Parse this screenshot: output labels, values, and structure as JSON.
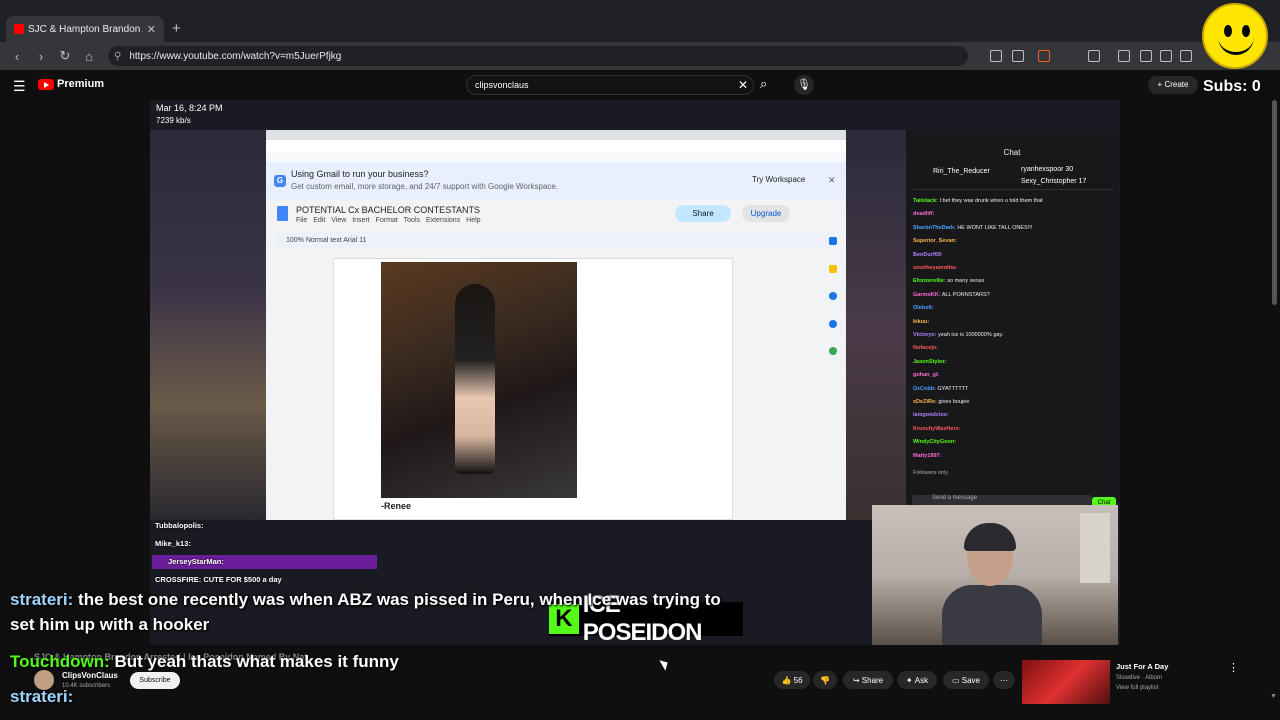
{
  "browser": {
    "tab_title": "SJC & Hampton Brandon Arr",
    "new_tab": "+",
    "url": "https://www.youtube.com/watch?v=m5JuerPfjkg"
  },
  "youtube": {
    "logo": "Premium",
    "search_value": "clipsvonclaus",
    "create": "+ Create",
    "subs_overlay": "Subs: 0"
  },
  "stream": {
    "date": "Mar 16, 8:24 PM",
    "bitrate": "7239 kb/s"
  },
  "inner": {
    "banner_title": "Using Gmail to run your business?",
    "banner_sub": "Get custom email, more storage, and 24/7 support with Google Workspace.",
    "banner_try": "Try Workspace",
    "doc_title": "POTENTIAL Cx BACHELOR CONTESTANTS",
    "doc_menu": "File Edit View Insert Format Tools Extensions Help",
    "share": "Share",
    "upgrade": "Upgrade",
    "toolbar": "100%   Normal text   Arial   11",
    "caption": "-Renee"
  },
  "chat": {
    "header": "Chat",
    "gift_user": "Riri_The_Reducer",
    "top_users": [
      "ryanhexspoor 30",
      "Sexy_Christopher 17"
    ],
    "lines": [
      {
        "u": "Tailstack:",
        "m": "I bet they was drunk when u told them that"
      },
      {
        "u": "deadliff:",
        "m": ""
      },
      {
        "u": "SharbnTheDark:",
        "m": "HE WONT LIKE TALL ONES!!!"
      },
      {
        "u": "Superior_Sevan:",
        "m": ""
      },
      {
        "u": "BenDurf69:",
        "m": ""
      },
      {
        "u": "smotheyamotha:",
        "m": ""
      },
      {
        "u": "Efonzerellie:",
        "m": "so many xenas"
      },
      {
        "u": "GarmoKK:",
        "m": "ALL PORNSTARS?"
      },
      {
        "u": "Olebolt:",
        "m": ""
      },
      {
        "u": "kikuu:",
        "m": ""
      },
      {
        "u": "Victorye:",
        "m": "yeah ice is 1000000% gay."
      },
      {
        "u": "Nofacejn:",
        "m": ""
      },
      {
        "u": "JasonStylez:",
        "m": ""
      },
      {
        "u": "gohan_gt:",
        "m": ""
      },
      {
        "u": "OzCobb:",
        "m": "GYATTTTTT"
      },
      {
        "u": "xDeZiRe:",
        "m": "gives boujee"
      },
      {
        "u": "iamgoodcloe:",
        "m": ""
      },
      {
        "u": "KrunchyWasHere:",
        "m": ""
      },
      {
        "u": "WindyCityGoon:",
        "m": ""
      },
      {
        "u": "Matty1997:",
        "m": ""
      }
    ],
    "followers_only": "Followers only",
    "input_placeholder": "Send a message",
    "send": "Chat"
  },
  "overlay": {
    "names": [
      "Tubbalopolis:",
      "Mike_k13:",
      "JerseyStarMan:",
      "CROSSFIRE: CUTE FOR $500 a day"
    ],
    "kick_letter": "K",
    "kick_name": "ICE POSEIDON",
    "sub1_name": "strateri:",
    "sub1_text": " the best one recently was when ABZ was pissed in Peru, when Ice was trying to",
    "sub2_text": "set him up with a hooker",
    "sub3_name": "Touchdown:",
    "sub3_text": " But yeah thats what makes it funny",
    "sub4_name": "strateri:",
    "faded_title": "SJC & Hampton Brandon Arrested | Ice Poseidon Named By Nat"
  },
  "channel": {
    "name": "ClipsVonClaus",
    "subs": "10.4K subscribers",
    "subscribe": "Subscribe",
    "likes": "56",
    "share": "Share",
    "ask": "Ask",
    "save": "Save"
  },
  "recommend": {
    "title": "Just For A Day",
    "artist": "Slowdive · Album",
    "playlist": "View full playlist"
  }
}
